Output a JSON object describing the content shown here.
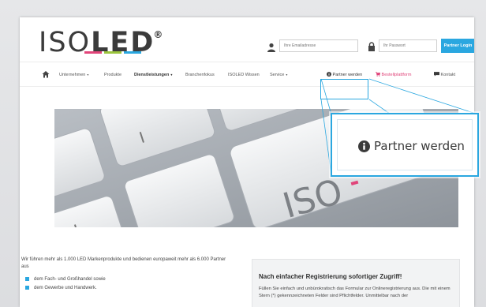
{
  "brand": {
    "logo_prefix": "ISO",
    "logo_led": "LED",
    "logo_mark": "®",
    "bar_colors": [
      "#e2457a",
      "#9bc53d",
      "#2aa7e0"
    ]
  },
  "login": {
    "email_placeholder": "Ihre Emailadresse",
    "password_placeholder": "Ihr Passwort",
    "button_label": "Partner Login",
    "accent_color": "#2aa7e0"
  },
  "nav": {
    "items": [
      {
        "label": "Unternehmen",
        "caret": "▾"
      },
      {
        "label": "Produkte"
      },
      {
        "label": "Dienstleistungen",
        "caret": "▾"
      },
      {
        "label": "Branchenfokus"
      },
      {
        "label": "ISOLED Wissen"
      },
      {
        "label": "Service",
        "caret": "▾"
      }
    ],
    "partner_label": "Partner werden",
    "platform_label": "Bestellplattform",
    "contact_label": "Kontakt",
    "platform_color": "#e0457a"
  },
  "hero": {
    "key_text": "ISO"
  },
  "content": {
    "intro": "Wir führen mehr als 1.000 LED Markenprodukte und bedienen europaweit mehr als 6.000 Partner aus",
    "bullets": [
      "dem Fach- und Großhandel sowie",
      "dem Gewerbe und Handwerk."
    ],
    "register_title": "Nach einfacher Registrierung sofortiger Zugriff!",
    "register_text": "Füllen Sie einfach und unbürokratisch das Formular zur Onlineregistrierung aus. Die mit einem Stern (*) gekennzeichneten Felder sind Pflichtfelder. Unmittelbar nach der"
  },
  "zoom": {
    "label": "Partner werden"
  }
}
